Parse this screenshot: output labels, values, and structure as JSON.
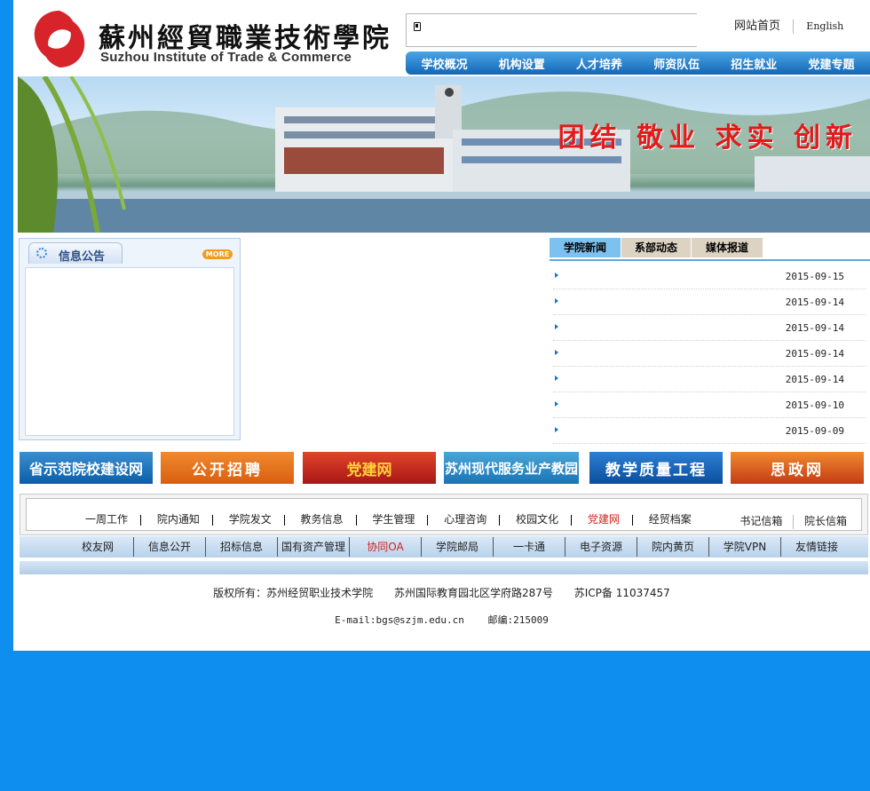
{
  "school": {
    "name_cn": "蘇州經貿職業技術學院",
    "name_en": "Suzhou Institute of Trade & Commerce"
  },
  "top_links": {
    "home": "网站首页",
    "english": "English"
  },
  "main_nav": [
    "学校概况",
    "机构设置",
    "人才培养",
    "师资队伍",
    "招生就业",
    "党建专题"
  ],
  "banner": {
    "slogan": "团结 敬业 求实 创新"
  },
  "notice": {
    "title": "信息公告",
    "more": "MORE"
  },
  "news": {
    "tabs": [
      "学院新闻",
      "系部动态",
      "媒体报道"
    ],
    "dates": [
      "2015-09-15",
      "2015-09-14",
      "2015-09-14",
      "2015-09-14",
      "2015-09-14",
      "2015-09-10",
      "2015-09-09"
    ]
  },
  "ads": [
    "省示范院校建设网",
    "公开招聘",
    "党建网",
    "苏州现代服务业产教园",
    "教学质量工程",
    "思政网"
  ],
  "quick_links": [
    "一周工作",
    "院内通知",
    "学院发文",
    "教务信息",
    "学生管理",
    "心理咨询",
    "校园文化",
    "党建网",
    "经贸档案"
  ],
  "quick_right": [
    "书记信箱",
    "院长信箱"
  ],
  "links2": [
    "校友网",
    "信息公开",
    "招标信息",
    "国有资产管理",
    "协同OA",
    "学院邮局",
    "一卡通",
    "电子资源",
    "院内黄页",
    "学院VPN",
    "友情链接"
  ],
  "footer": {
    "copyright": "版权所有：苏州经贸职业技术学院",
    "address": "苏州国际教育园北区学府路287号",
    "icp": "苏ICP备 11037457",
    "email": "E-mail:bgs@szjm.edu.cn",
    "postcode": "邮编:215009"
  },
  "colors": {
    "brand_blue": "#0e8fef",
    "accent_red": "#d41f1f"
  }
}
